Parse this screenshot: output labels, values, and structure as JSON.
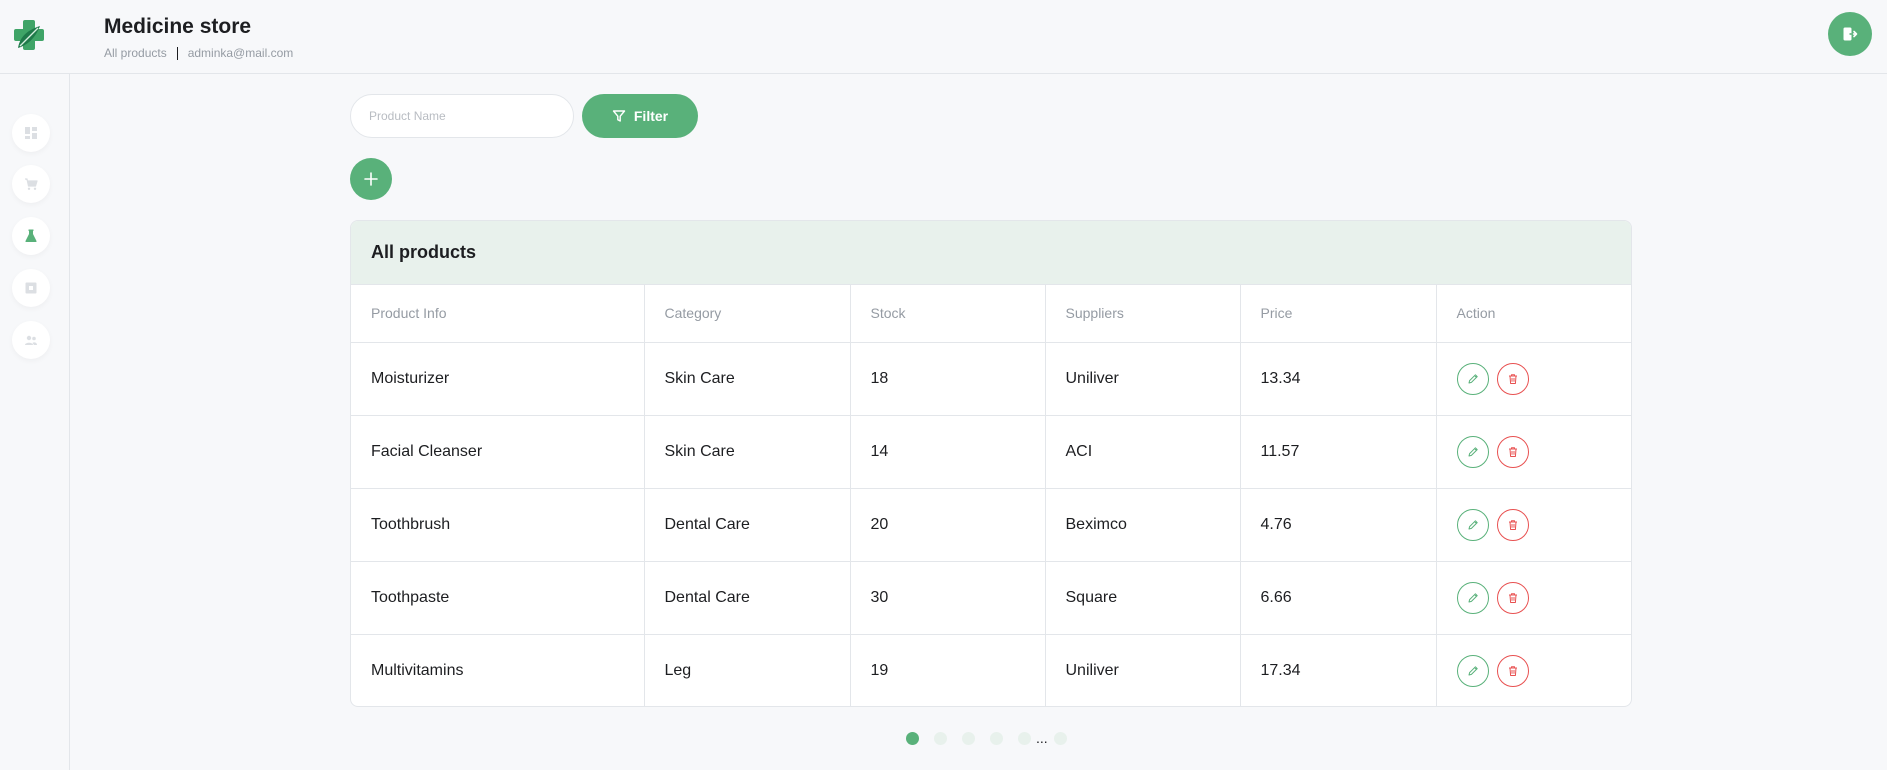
{
  "header": {
    "title": "Medicine store",
    "subtitle_page": "All products",
    "subtitle_email": "adminka@mail.com"
  },
  "sidebar": {
    "items": [
      {
        "name": "dashboard",
        "icon": "dashboard-icon",
        "active": false
      },
      {
        "name": "orders",
        "icon": "cart-icon",
        "active": false
      },
      {
        "name": "products",
        "icon": "flask-icon",
        "active": true
      },
      {
        "name": "suppliers",
        "icon": "box-icon",
        "active": false
      },
      {
        "name": "customers",
        "icon": "users-icon",
        "active": false
      }
    ]
  },
  "filter": {
    "placeholder": "Product Name",
    "value": "",
    "button_label": "Filter"
  },
  "table": {
    "title": "All products",
    "columns": [
      "Product Info",
      "Category",
      "Stock",
      "Suppliers",
      "Price",
      "Action"
    ],
    "rows": [
      {
        "name": "Moisturizer",
        "category": "Skin Care",
        "stock": "18",
        "supplier": "Uniliver",
        "price": "13.34"
      },
      {
        "name": "Facial Cleanser",
        "category": "Skin Care",
        "stock": "14",
        "supplier": "ACI",
        "price": "11.57"
      },
      {
        "name": "Toothbrush",
        "category": "Dental Care",
        "stock": "20",
        "supplier": "Beximco",
        "price": "4.76"
      },
      {
        "name": "Toothpaste",
        "category": "Dental Care",
        "stock": "30",
        "supplier": "Square",
        "price": "6.66"
      },
      {
        "name": "Multivitamins",
        "category": "Leg",
        "stock": "19",
        "supplier": "Uniliver",
        "price": "17.34"
      }
    ]
  },
  "pagination": {
    "current_page": 1,
    "ellipsis": "..."
  },
  "colors": {
    "accent": "#59b17a",
    "accent_light": "#e8f1ec",
    "danger": "#e85050",
    "background": "#f7f8fa"
  }
}
